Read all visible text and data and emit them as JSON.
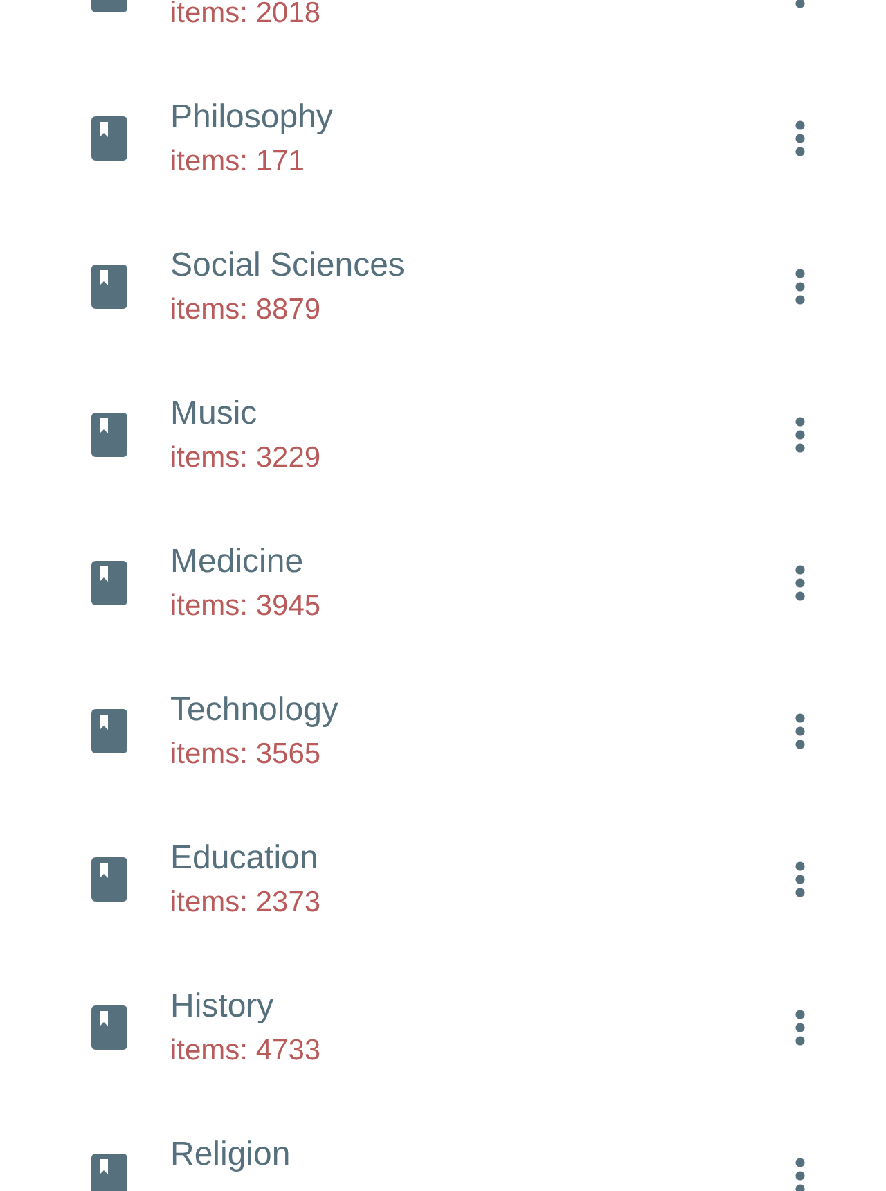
{
  "categories": [
    {
      "count": "items: 2018"
    },
    {
      "title": "Philosophy",
      "count": "items: 171"
    },
    {
      "title": "Social Sciences",
      "count": "items: 8879"
    },
    {
      "title": "Music",
      "count": "items: 3229"
    },
    {
      "title": "Medicine",
      "count": "items: 3945"
    },
    {
      "title": "Technology",
      "count": "items: 3565"
    },
    {
      "title": "Education",
      "count": "items: 2373"
    },
    {
      "title": "History",
      "count": "items: 4733"
    },
    {
      "title": "Religion"
    }
  ]
}
